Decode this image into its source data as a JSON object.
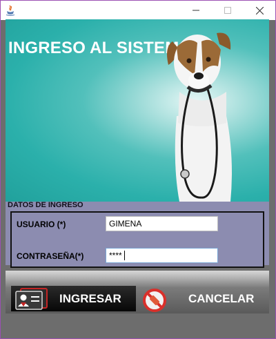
{
  "window": {
    "title": "",
    "controls": [
      "minimize-icon",
      "maximize-icon",
      "close-icon"
    ]
  },
  "banner": {
    "title": "INGRESO AL SISTEMA"
  },
  "login": {
    "group_title": "DATOS DE INGRESO",
    "user_label": "USUARIO (*)",
    "user_value": "GIMENA",
    "password_label": "CONTRASEÑA(*)",
    "password_value": "****"
  },
  "buttons": {
    "ingresar": "INGRESAR",
    "cancelar": "CANCELAR"
  },
  "colors": {
    "window_border": "#9b4fb3",
    "banner_teal": "#2bb0ab",
    "form_background": "#8c8cb0",
    "button_bar": "#6d6d6d"
  }
}
